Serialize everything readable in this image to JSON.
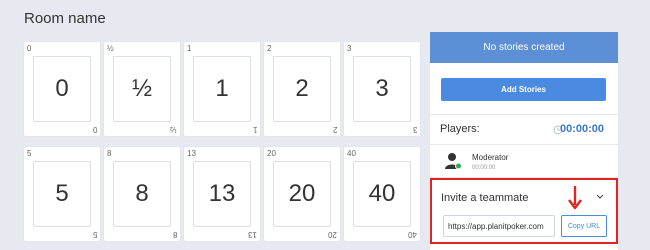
{
  "room": {
    "title": "Room name"
  },
  "cards": [
    {
      "value": "0",
      "corner": "0"
    },
    {
      "value": "½",
      "corner": "½"
    },
    {
      "value": "1",
      "corner": "1"
    },
    {
      "value": "2",
      "corner": "2"
    },
    {
      "value": "3",
      "corner": "3"
    },
    {
      "value": "5",
      "corner": "5"
    },
    {
      "value": "8",
      "corner": "8"
    },
    {
      "value": "13",
      "corner": "13"
    },
    {
      "value": "20",
      "corner": "20"
    },
    {
      "value": "40",
      "corner": "40"
    }
  ],
  "stories": {
    "header": "No stories created",
    "add_button": "Add Stories"
  },
  "players": {
    "label": "Players:",
    "timer": "00:00:00",
    "list": [
      {
        "name": "Moderator",
        "time": "00:00:00"
      }
    ]
  },
  "invite": {
    "title": "Invite a teammate",
    "url": "https://app.planitpoker.com",
    "copy_button": "Copy URL"
  },
  "colors": {
    "accent": "#4a8ae0",
    "header_blue": "#5c8fd6",
    "highlight_red": "#e02424",
    "online_green": "#2eaa4a"
  }
}
